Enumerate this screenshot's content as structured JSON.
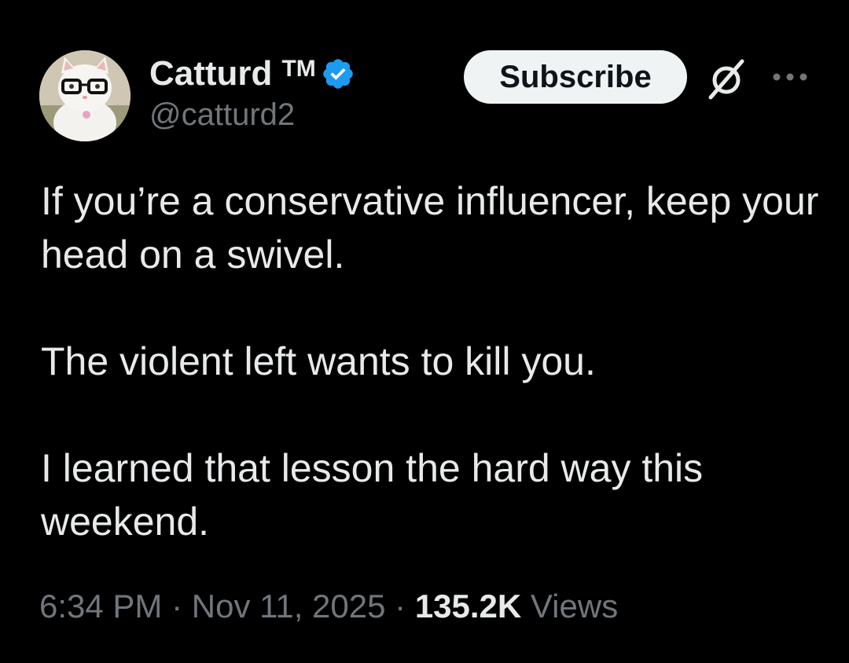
{
  "author": {
    "display_name": "Catturd",
    "trademark": "TM",
    "handle": "@catturd2",
    "verified_icon": "verified-badge-icon",
    "avatar_icon": "cat-with-glasses-avatar"
  },
  "actions": {
    "subscribe_label": "Subscribe",
    "grok_icon": "grok-icon",
    "more_icon": "more-options-icon"
  },
  "tweet": {
    "paragraphs": [
      "If you’re a conservative influencer, keep your head on a swivel.",
      "The violent left wants to kill you.",
      "I learned that lesson the hard way this weekend."
    ]
  },
  "meta": {
    "time": "6:34 PM",
    "separator": " · ",
    "date": "Nov 11, 2025",
    "views_count": "135.2K",
    "views_label": " Views"
  },
  "colors": {
    "background": "#000000",
    "text_primary": "#e7e9ea",
    "text_secondary": "#71767b",
    "verified_blue": "#1d9bf0",
    "button_bg": "#eff3f4",
    "button_text": "#0f1419"
  }
}
